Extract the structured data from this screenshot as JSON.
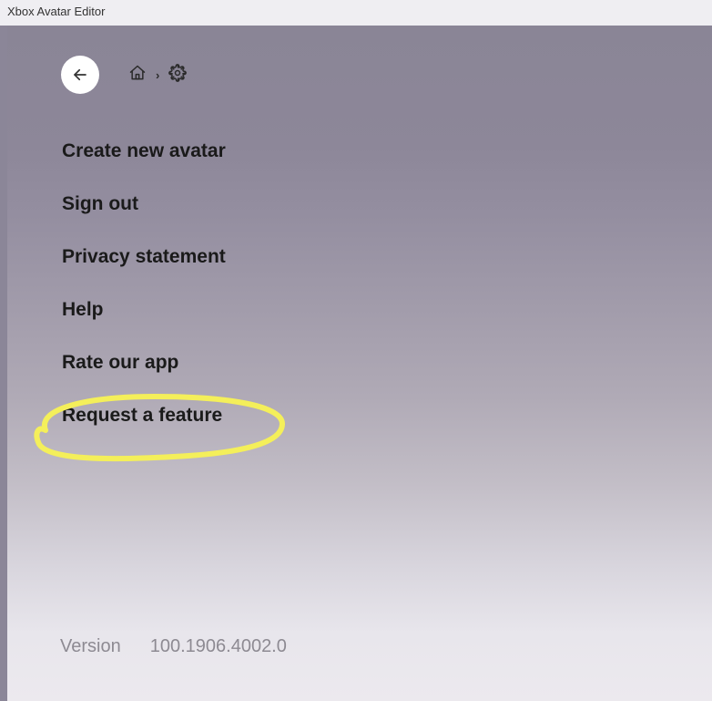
{
  "window_title": "Xbox Avatar Editor",
  "menu": {
    "items": [
      "Create new avatar",
      "Sign out",
      "Privacy statement",
      "Help",
      "Rate our app",
      "Request a feature"
    ]
  },
  "footer": {
    "version_label": "Version",
    "version_number": "100.1906.4002.0"
  }
}
